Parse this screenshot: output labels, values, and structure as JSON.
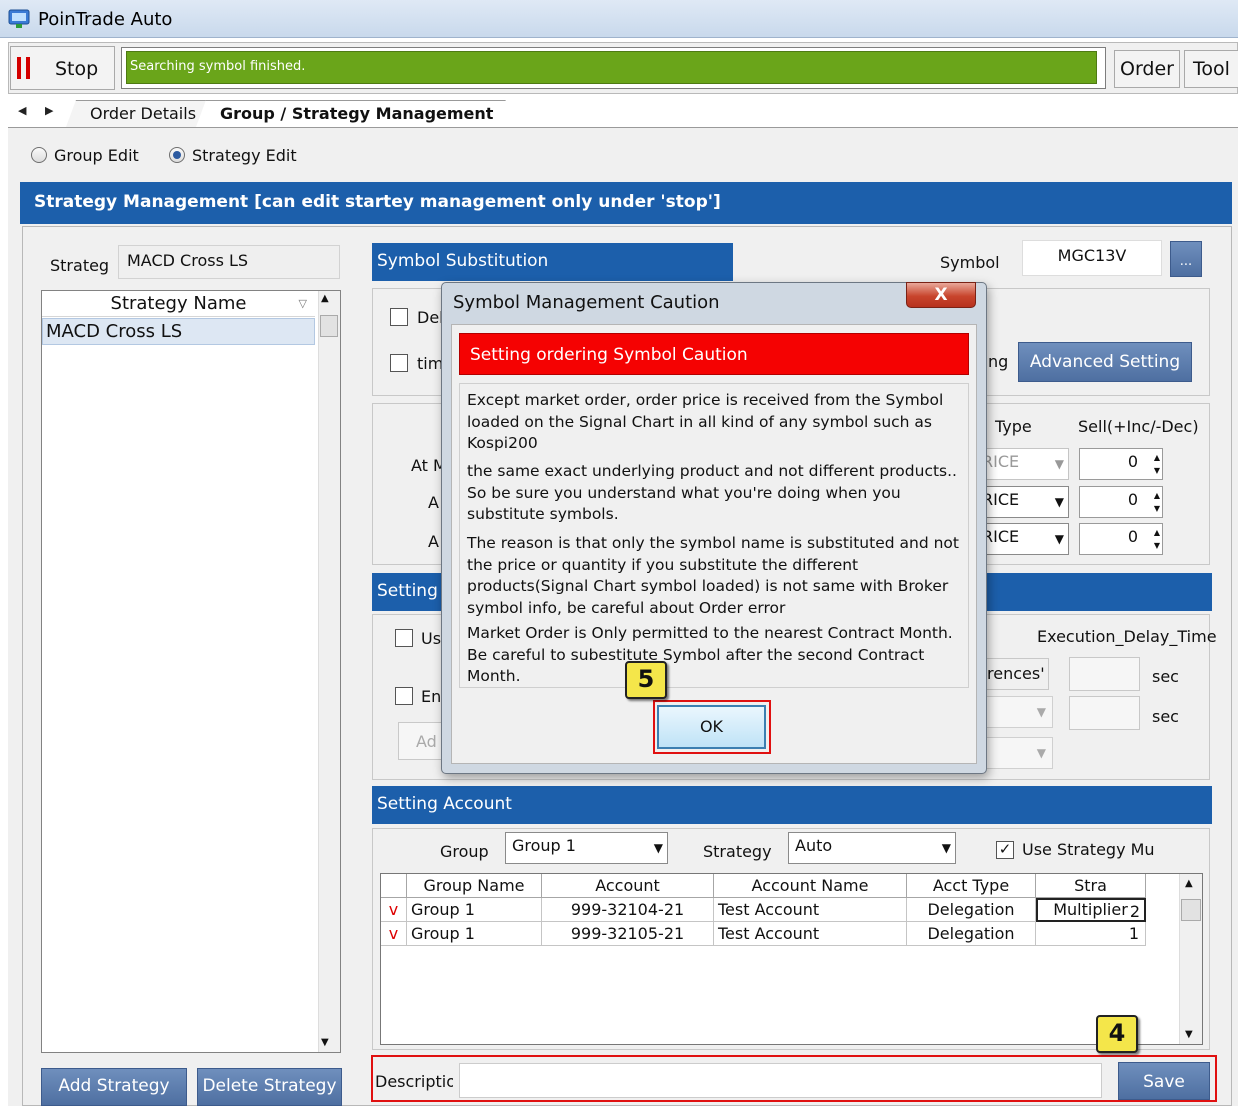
{
  "window": {
    "title": "PoinTrade Auto"
  },
  "toolbar": {
    "stop_label": "Stop",
    "status_text": "Searching symbol finished.",
    "order_label": "Order",
    "tools_label": "Tool"
  },
  "tabs": [
    {
      "label": "Order Details"
    },
    {
      "label": "Group / Strategy Management"
    }
  ],
  "edit_mode": {
    "group_edit": "Group Edit",
    "strategy_edit": "Strategy Edit",
    "selected": "Strategy Edit"
  },
  "header": {
    "title": "Strategy Management [can edit startey management only under 'stop']"
  },
  "strategy": {
    "label": "Strategy",
    "value": "MACD Cross LS",
    "list_header": "Strategy Name",
    "items": [
      "MACD Cross LS"
    ],
    "add_label": "Add Strategy",
    "delete_label": "Delete Strategy"
  },
  "symbol_sub": {
    "header": "Symbol Substitution",
    "symbol_label": "Symbol",
    "symbol_value": "MGC13V",
    "browse_label": "...",
    "check1": "Del",
    "check2": "tim",
    "advanced_label": "Advanced Setting",
    "partial_ng": "ng"
  },
  "price": {
    "type_header": "Type",
    "sell_header": "Sell(+Inc/-Dec)",
    "row_labels": [
      "At M",
      "A",
      "A"
    ],
    "combo_values": [
      "RICE",
      "RICE",
      "RICE"
    ],
    "spin_values": [
      "0",
      "0",
      "0"
    ]
  },
  "setting_a": {
    "header": "Setting A",
    "check1": "Us",
    "check2": "En",
    "add_partial": "Ad",
    "exec_delay_label": "Execution_Delay_Time",
    "references_partial": "rences'",
    "sec1": "sec",
    "sec2": "sec"
  },
  "setting_account": {
    "header": "Setting Account",
    "group_label": "Group",
    "group_value": "Group 1",
    "strategy_label": "Strategy",
    "strategy_value": "Auto",
    "use_multiplier_label": "Use Strategy Mult",
    "columns": [
      "Group Name",
      "Account",
      "Account Name",
      "Acct Type",
      "Stra Multiplier"
    ],
    "rows": [
      {
        "flag": "v",
        "group": "Group 1",
        "account": "999-32104-21",
        "name": "Test Account",
        "type": "Delegation",
        "multiplier": "2"
      },
      {
        "flag": "v",
        "group": "Group 1",
        "account": "999-32105-21",
        "name": "Test Account",
        "type": "Delegation",
        "multiplier": "1"
      }
    ]
  },
  "description": {
    "label": "Description",
    "value": ""
  },
  "save_label": "Save",
  "dialog": {
    "title": "Symbol Management Caution",
    "close_label": "X",
    "caution_title": "Setting ordering Symbol Caution",
    "paragraphs": [
      "Except market order, order price is received from  the Symbol loaded on the Signal Chart in all kind of any symbol such as Kospi200",
      "the same exact underlying product and not different products.. So be sure you understand what you're doing when you substitute symbols.",
      "The reason is that only the symbol name is substituted and not the price or quantity if you substitute the different products(Signal Chart symbol loaded) is not same with Broker symbol info, be careful about Order error",
      "Market Order is Only permitted to the nearest Contract Month. Be careful to subestitute Symbol after the second Contract Month."
    ],
    "ok_label": "OK"
  },
  "annotations": {
    "badge4": "4",
    "badge5": "5",
    "highlight_color": "#e01010",
    "badge_color": "#f4e64a"
  }
}
